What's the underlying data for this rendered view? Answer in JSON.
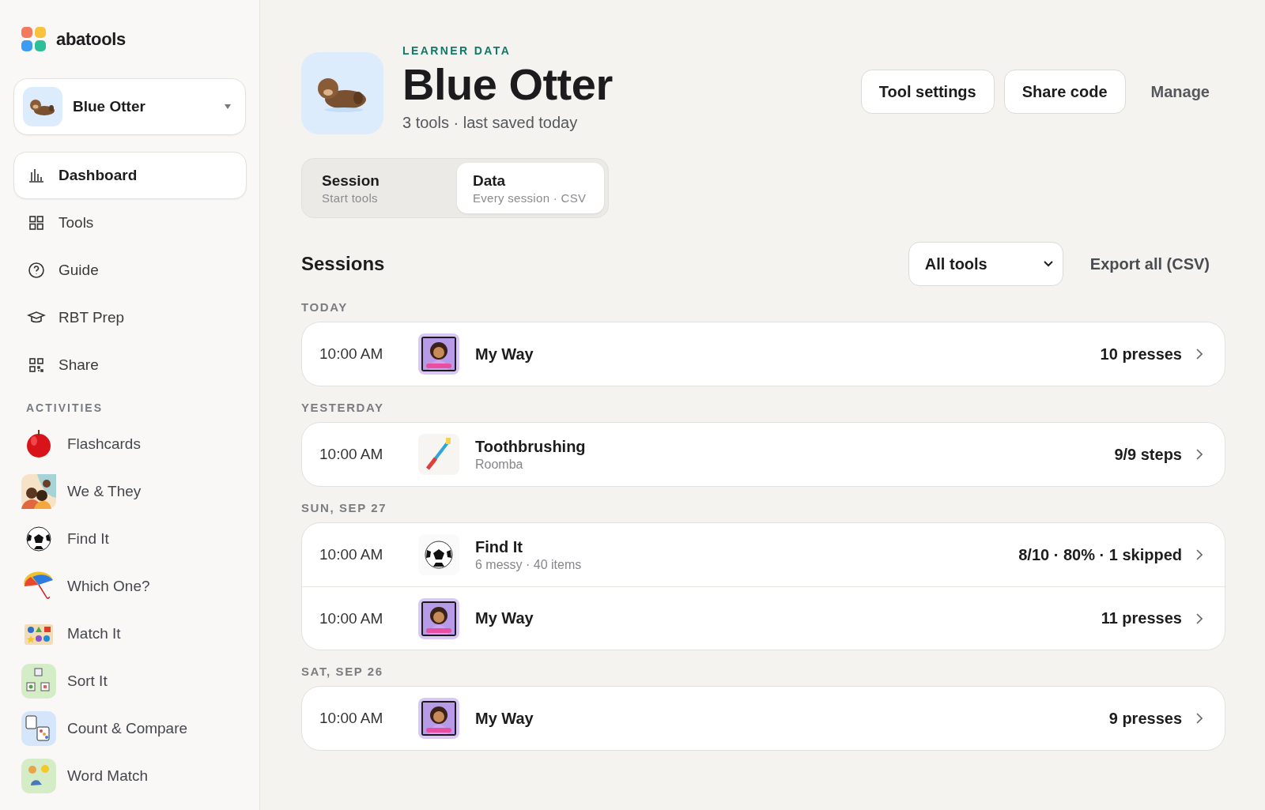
{
  "brand": {
    "name": "abatools"
  },
  "learner_picker": {
    "name": "Blue Otter"
  },
  "nav": [
    {
      "label": "Dashboard",
      "selected": true
    },
    {
      "label": "Tools",
      "selected": false
    },
    {
      "label": "Guide",
      "selected": false
    },
    {
      "label": "RBT Prep",
      "selected": false
    },
    {
      "label": "Share",
      "selected": false
    }
  ],
  "activities_heading": "ACTIVITIES",
  "activities": [
    {
      "label": "Flashcards"
    },
    {
      "label": "We & They"
    },
    {
      "label": "Find It"
    },
    {
      "label": "Which One?"
    },
    {
      "label": "Match It"
    },
    {
      "label": "Sort It"
    },
    {
      "label": "Count & Compare"
    },
    {
      "label": "Word Match"
    }
  ],
  "header": {
    "eyebrow": "LEARNER DATA",
    "title": "Blue Otter",
    "subtitle": "3 tools · last saved today",
    "buttons": [
      "Tool settings",
      "Share code"
    ],
    "link": "Manage"
  },
  "mode_tabs": [
    {
      "label": "Session",
      "caption": "Start tools",
      "selected": false
    },
    {
      "label": "Data",
      "caption": "Every session · CSV",
      "selected": true
    }
  ],
  "sessions": {
    "title": "Sessions",
    "filter": "All tools",
    "export": "Export all (CSV)",
    "groups": [
      {
        "day": "TODAY",
        "rows": [
          {
            "time": "10:00 AM",
            "tool": "My Way",
            "result": "10 presses"
          }
        ]
      },
      {
        "day": "YESTERDAY",
        "rows": [
          {
            "time": "10:00 AM",
            "tool": "Toothbrushing",
            "detail": "Roomba",
            "result": "9/9 steps"
          }
        ]
      },
      {
        "day": "SUN, SEP 27",
        "rows": [
          {
            "time": "10:00 AM",
            "tool": "Find It",
            "detail": "6 messy · 40 items",
            "result": "8/10 · 80% · 1 skipped"
          },
          {
            "time": "10:00 AM",
            "tool": "My Way",
            "result": "11 presses"
          }
        ]
      },
      {
        "day": "SAT, SEP 26",
        "rows": [
          {
            "time": "10:00 AM",
            "tool": "My Way",
            "result": "9 presses"
          }
        ]
      }
    ]
  }
}
